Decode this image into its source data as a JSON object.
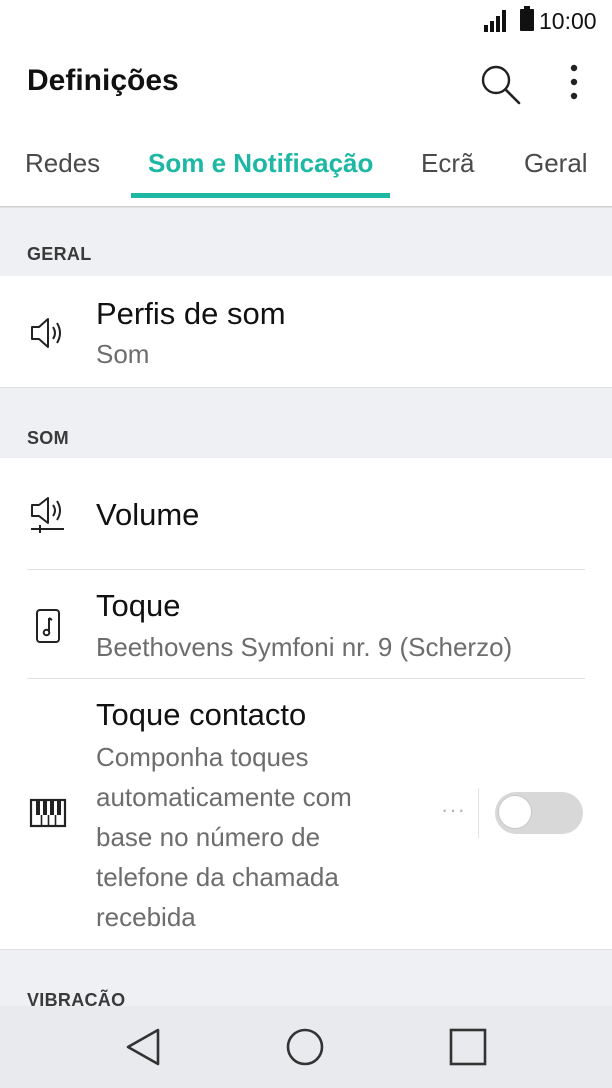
{
  "status_bar": {
    "time": "10:00",
    "signal_icon": "signal-icon",
    "battery_icon": "battery-icon"
  },
  "app_bar": {
    "title": "Definições",
    "search_icon": "search-icon",
    "more_icon": "more-vert-icon"
  },
  "tabs": [
    {
      "label": "Redes",
      "active": false
    },
    {
      "label": "Som e Notificação",
      "active": true
    },
    {
      "label": "Ecrã",
      "active": false
    },
    {
      "label": "Geral",
      "active": false
    }
  ],
  "accent_color": "#1db8a3",
  "sections": {
    "geral": {
      "header": "GERAL",
      "items": [
        {
          "title": "Perfis de som",
          "subtitle": "Som",
          "icon": "speaker-icon"
        }
      ]
    },
    "som": {
      "header": "SOM",
      "items": [
        {
          "title": "Volume",
          "icon": "volume-icon"
        },
        {
          "title": "Toque",
          "subtitle": "Beethovens Symfoni nr. 9 (Scherzo)",
          "icon": "ringtone-icon"
        },
        {
          "title": "Toque contacto",
          "subtitle_lines": [
            "Componha toques",
            "automaticamente com",
            "base no número de",
            "telefone da chamada",
            "recebida"
          ],
          "icon": "piano-icon",
          "more": "···",
          "toggle_on": false
        }
      ]
    },
    "vibracao": {
      "header": "VIBRAÇÃO"
    }
  },
  "nav_bar": {
    "back_icon": "back-icon",
    "home_icon": "home-icon",
    "recents_icon": "recents-icon"
  }
}
